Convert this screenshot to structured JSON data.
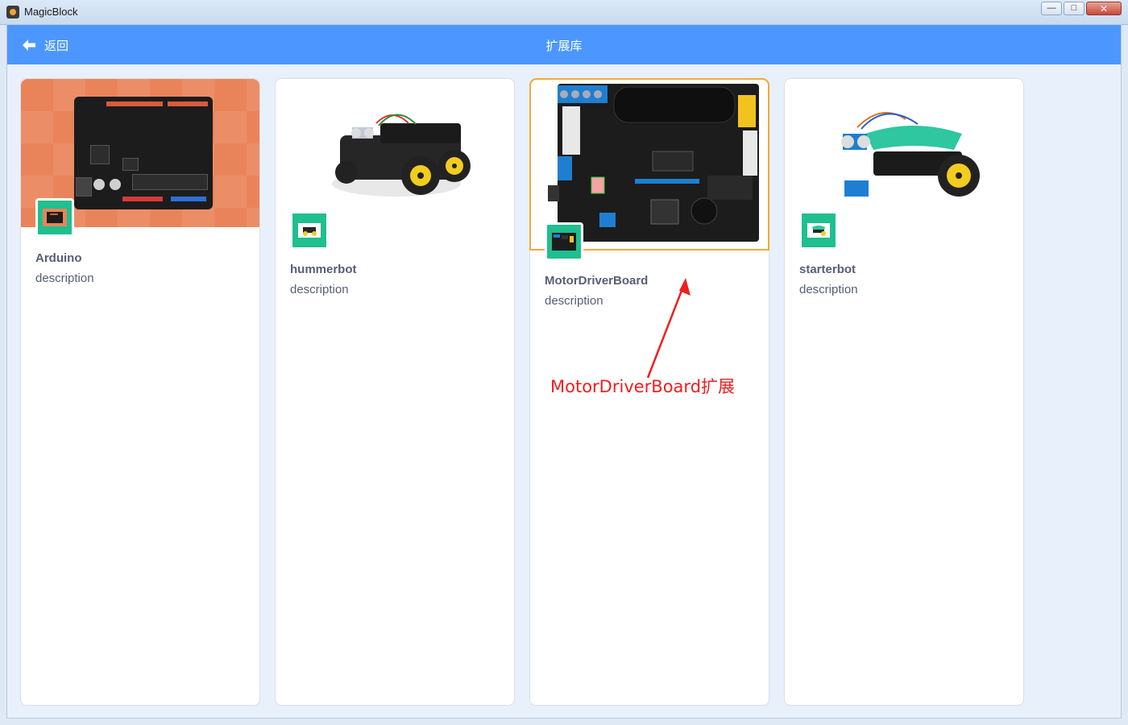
{
  "window": {
    "title": "MagicBlock",
    "minimize_glyph": "—",
    "maximize_glyph": "□",
    "close_glyph": "✕"
  },
  "header": {
    "back_label": "返回",
    "title": "扩展库",
    "color": "#4c97ff"
  },
  "cards": [
    {
      "name": "Arduino",
      "description": "description",
      "icon": "arduino-board-icon"
    },
    {
      "name": "hummerbot",
      "description": "description",
      "icon": "robot-car-icon"
    },
    {
      "name": "MotorDriverBoard",
      "description": "description",
      "icon": "motor-driver-board-icon"
    },
    {
      "name": "starterbot",
      "description": "description",
      "icon": "robot-car-icon"
    }
  ],
  "annotation": {
    "text": "MotorDriverBoard扩展",
    "color": "#f01e1e"
  },
  "colors": {
    "thumb_bg": "#1fbf8f",
    "selected_outline": "#f4a83a",
    "text": "#575e75"
  }
}
